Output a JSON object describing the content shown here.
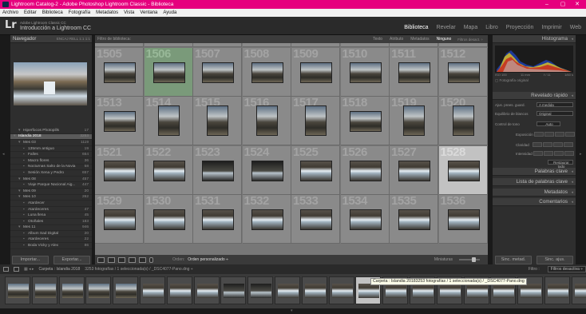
{
  "window": {
    "title": "Lightroom Catalog-2 - Adobe Photoshop Lightroom Classic - Biblioteca"
  },
  "menu": [
    "Archivo",
    "Editar",
    "Biblioteca",
    "Fotografía",
    "Metadatos",
    "Vista",
    "Ventana",
    "Ayuda"
  ],
  "identity": {
    "logo": "Lr",
    "line1": "Adobe Lightroom Classic CC",
    "line2": "Introducción a Lightroom CC"
  },
  "modules": [
    "Biblioteca",
    "Revelar",
    "Mapa",
    "Libro",
    "Proyección",
    "Imprimir",
    "Web"
  ],
  "active_module": "Biblioteca",
  "navigator": {
    "title": "Navegador",
    "options": "ENCAJ  RELL  1:1  1:1"
  },
  "collections": [
    {
      "name": "Hiperfocos Photopills",
      "count": "17",
      "indent": 1
    },
    {
      "name": "Islandia 2018",
      "count": "3253",
      "indent": 0,
      "selected": true
    },
    {
      "name": "Mes 03",
      "count": "1119",
      "indent": 1
    },
    {
      "name": "135mm antiguo",
      "count": "19",
      "indent": 2
    },
    {
      "name": "Falles",
      "count": "664",
      "indent": 2
    },
    {
      "name": "Macro flores",
      "count": "36",
      "indent": 2
    },
    {
      "name": "Nocturnas Salto de la Novia",
      "count": "58",
      "indent": 2
    },
    {
      "name": "Sesión Xena y Pedro",
      "count": "657",
      "indent": 2
    },
    {
      "name": "Mes 08",
      "count": "457",
      "indent": 1
    },
    {
      "name": "Viaje Parque Nacional Aig...",
      "count": "447",
      "indent": 2
    },
    {
      "name": "Mes 09",
      "count": "20",
      "indent": 1
    },
    {
      "name": "Mes 10",
      "count": "262",
      "indent": 1
    },
    {
      "name": "Atardecer",
      "count": "",
      "indent": 2
    },
    {
      "name": "Atardeceres",
      "count": "47",
      "indent": 2
    },
    {
      "name": "Luna llena",
      "count": "45",
      "indent": 2
    },
    {
      "name": "Otoñales",
      "count": "183",
      "indent": 2
    },
    {
      "name": "Mes 11",
      "count": "946",
      "indent": 1
    },
    {
      "name": "Album Sad Digital",
      "count": "20",
      "indent": 2
    },
    {
      "name": "Atardeceres",
      "count": "22",
      "indent": 2
    },
    {
      "name": "Boda Vicky y Alex",
      "count": "86",
      "indent": 2
    }
  ],
  "left_buttons": {
    "import": "Importar...",
    "export": "Exportar..."
  },
  "filter_bar": {
    "label": "Filtro de biblioteca:",
    "tabs": [
      "Texto",
      "Atributo",
      "Metadatos",
      "Ninguno"
    ],
    "active": "Ninguno",
    "preset": "Filtros desact. ÷"
  },
  "grid": {
    "rows": [
      {
        "numbers": [
          "",
          "",
          "",
          "",
          "",
          "",
          "",
          ""
        ],
        "types": [
          "land",
          "land",
          "land",
          "land",
          "land",
          "land",
          "land",
          "land"
        ]
      },
      {
        "numbers": [
          "1505",
          "1506",
          "1507",
          "1508",
          "1509",
          "1510",
          "1511",
          "1512"
        ],
        "types": [
          "land",
          "land",
          "land",
          "land",
          "land",
          "land",
          "land",
          "land"
        ],
        "highlight": 1
      },
      {
        "numbers": [
          "1513",
          "1514",
          "1515",
          "1516",
          "1517",
          "1518",
          "1519",
          "1520"
        ],
        "types": [
          "land",
          "port",
          "port",
          "port",
          "port",
          "land",
          "port",
          "port"
        ]
      },
      {
        "numbers": [
          "1521",
          "1522",
          "1523",
          "1524",
          "1525",
          "1526",
          "1527",
          "1528"
        ],
        "types": [
          "river",
          "river",
          "dark",
          "dark",
          "river",
          "river",
          "river",
          "river"
        ],
        "selected": 7
      },
      {
        "numbers": [
          "1529",
          "1530",
          "1531",
          "1532",
          "1533",
          "1534",
          "1535",
          "1536"
        ],
        "types": [
          "river",
          "river",
          "river",
          "river",
          "river",
          "river",
          "river",
          "river"
        ]
      }
    ]
  },
  "toolbar": {
    "sort_label": "Orden:",
    "sort_value": "Orden personalizado ÷",
    "thumbs": "Miniaturas"
  },
  "right_panel": {
    "histogram": "Histograma",
    "histo_info": [
      "ISO 100",
      "11 mm",
      "f / 11",
      "1/60 s"
    ],
    "original": "Fotografía original",
    "quick_develop": "Revelado rápido",
    "preset_label": "Ajus. prees. guard.",
    "preset_value": "A medida",
    "wb_label": "Equilibrio de blancos",
    "wb_value": "Original",
    "tone_label": "Control de tono",
    "auto": "Auto",
    "sliders": [
      "Exposición",
      "Claridad",
      "Intensidad"
    ],
    "reset": "Restaurar todo",
    "keywords": "Palabras clave",
    "keyword_list": "Lista de palabras clave",
    "kw_default": "Por defecto",
    "metadata": "Metadatos",
    "comments": "Comentarios"
  },
  "right_buttons": {
    "sync_meta": "Sinc. metad.",
    "sync_set": "Sinc. ajus."
  },
  "filmstrip_bar": {
    "source": "Carpeta : Islandia 2018",
    "info": "3253 fotografías / 1 seleccionada(s) / _DSC4077-Pano.dng ÷",
    "filter_label": "Filtro :",
    "filter_value": "Filtros desactiva ÷"
  },
  "tooltip": "Carpeta : Islandia 20183253 fotografías / 1 seleccionada(s) / _DSC4077-Pano.dng",
  "colors": {
    "accent": "#e6007e",
    "panel": "#2e2e2e",
    "grid_bg": "#777777",
    "selected_cell": "#c2c2c2"
  }
}
